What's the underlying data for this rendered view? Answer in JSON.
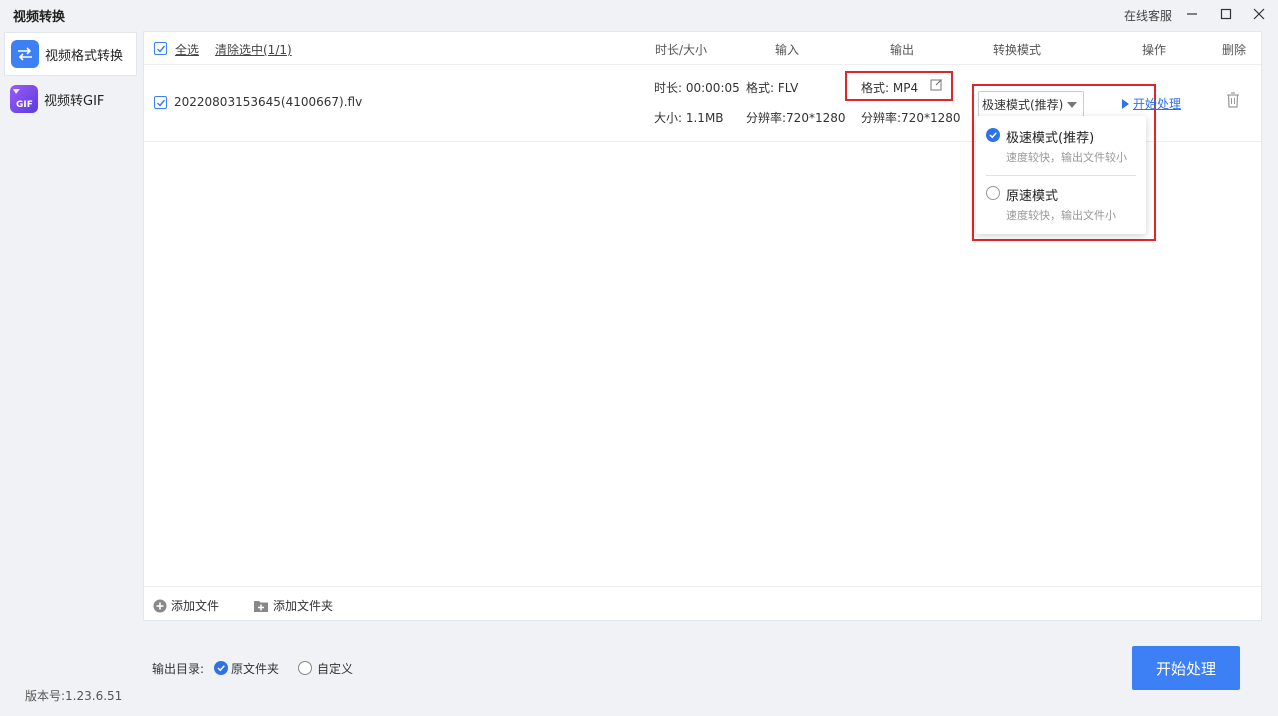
{
  "window": {
    "title": "视频转换",
    "online_service": "在线客服"
  },
  "sidebar": {
    "items": [
      {
        "label": "视频格式转换",
        "icon": "swap-arrows-icon",
        "active": true
      },
      {
        "label": "视频转GIF",
        "icon": "gif-icon",
        "active": false
      }
    ]
  },
  "list_header": {
    "select_all": "全选",
    "clear_selected": "清除选中(1/1)",
    "col_duration_size": "时长/大小",
    "col_input": "输入",
    "col_output": "输出",
    "col_mode": "转换模式",
    "col_action": "操作",
    "col_delete": "删除"
  },
  "file": {
    "name": "20220803153645(4100667).flv",
    "duration": "时长: 00:00:05",
    "size": "大小: 1.1MB",
    "input_format": "格式: FLV",
    "input_resolution": "分辨率:720*1280",
    "output_format": "格式: MP4",
    "output_resolution": "分辨率:720*1280",
    "mode_selected": "极速模式(推荐)",
    "start_link": "开始处理"
  },
  "mode_dropdown": {
    "options": [
      {
        "title": "极速模式(推荐)",
        "desc": "速度较快，输出文件较小",
        "checked": true
      },
      {
        "title": "原速模式",
        "desc": "速度较快，输出文件小",
        "checked": false
      }
    ]
  },
  "panel_footer": {
    "add_file": "添加文件",
    "add_folder": "添加文件夹"
  },
  "bottom": {
    "output_dir_label": "输出目录:",
    "opt_original": "原文件夹",
    "opt_custom": "自定义",
    "version": "版本号:1.23.6.51",
    "start_button": "开始处理"
  },
  "colors": {
    "accent": "#3d7ff5",
    "highlight_box": "#e0262b",
    "link": "#2f72e8"
  }
}
